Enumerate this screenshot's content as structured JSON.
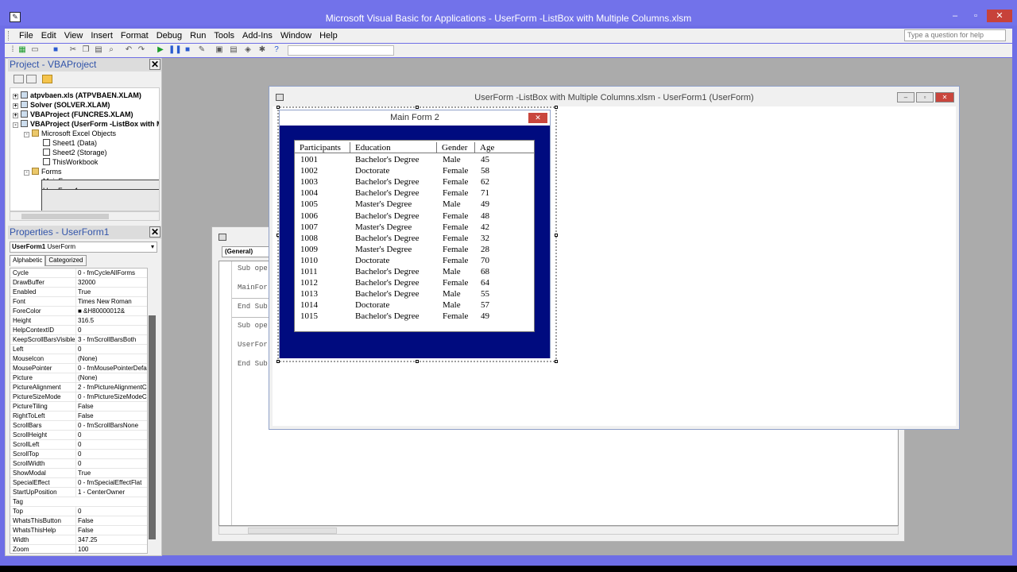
{
  "app": {
    "title": "Microsoft Visual Basic for Applications - UserForm -ListBox with Multiple Columns.xlsm",
    "window_buttons": [
      "‒",
      "▫",
      "✕"
    ]
  },
  "menu": [
    "File",
    "Edit",
    "View",
    "Insert",
    "Format",
    "Debug",
    "Run",
    "Tools",
    "Add-Ins",
    "Window",
    "Help"
  ],
  "help_placeholder": "Type a question for help",
  "project": {
    "title": "Project - VBAProject",
    "nodes": [
      {
        "label": "atpvbaen.xls (ATPVBAEN.XLAM)",
        "bold": true,
        "level": 0,
        "icon": "project-icon",
        "pm": "+"
      },
      {
        "label": "Solver (SOLVER.XLAM)",
        "bold": true,
        "level": 0,
        "icon": "project-icon",
        "pm": "+"
      },
      {
        "label": "VBAProject (FUNCRES.XLAM)",
        "bold": true,
        "level": 0,
        "icon": "project-icon",
        "pm": "+"
      },
      {
        "label": "VBAProject (UserForm -ListBox with Mult",
        "bold": true,
        "level": 0,
        "icon": "project-icon",
        "pm": "-"
      },
      {
        "label": "Microsoft Excel Objects",
        "bold": false,
        "level": 1,
        "icon": "folder-icon",
        "pm": "-"
      },
      {
        "label": "Sheet1 (Data)",
        "bold": false,
        "level": 2,
        "icon": "sheet-icon",
        "pm": ""
      },
      {
        "label": "Sheet2 (Storage)",
        "bold": false,
        "level": 2,
        "icon": "sheet-icon",
        "pm": ""
      },
      {
        "label": "ThisWorkbook",
        "bold": false,
        "level": 2,
        "icon": "sheet-icon",
        "pm": ""
      },
      {
        "label": "Forms",
        "bold": false,
        "level": 1,
        "icon": "folder-icon",
        "pm": "-"
      },
      {
        "label": "MainForm",
        "bold": false,
        "level": 2,
        "icon": "form-icon",
        "pm": ""
      },
      {
        "label": "UserForm1",
        "bold": false,
        "level": 2,
        "icon": "form-icon",
        "pm": ""
      }
    ]
  },
  "properties": {
    "title": "Properties - UserForm1",
    "object_name": "UserForm1",
    "object_type": "UserForm",
    "tabs": [
      "Alphabetic",
      "Categorized"
    ],
    "rows": [
      [
        "Cycle",
        "0 - fmCycleAllForms"
      ],
      [
        "DrawBuffer",
        "32000"
      ],
      [
        "Enabled",
        "True"
      ],
      [
        "Font",
        "Times New Roman"
      ],
      [
        "ForeColor",
        "■ &H80000012&"
      ],
      [
        "Height",
        "316.5"
      ],
      [
        "HelpContextID",
        "0"
      ],
      [
        "KeepScrollBarsVisible",
        "3 - fmScrollBarsBoth"
      ],
      [
        "Left",
        "0"
      ],
      [
        "MouseIcon",
        "(None)"
      ],
      [
        "MousePointer",
        "0 - fmMousePointerDefault"
      ],
      [
        "Picture",
        "(None)"
      ],
      [
        "PictureAlignment",
        "2 - fmPictureAlignmentCenter"
      ],
      [
        "PictureSizeMode",
        "0 - fmPictureSizeModeClip"
      ],
      [
        "PictureTiling",
        "False"
      ],
      [
        "RightToLeft",
        "False"
      ],
      [
        "ScrollBars",
        "0 - fmScrollBarsNone"
      ],
      [
        "ScrollHeight",
        "0"
      ],
      [
        "ScrollLeft",
        "0"
      ],
      [
        "ScrollTop",
        "0"
      ],
      [
        "ScrollWidth",
        "0"
      ],
      [
        "ShowModal",
        "True"
      ],
      [
        "SpecialEffect",
        "0 - fmSpecialEffectFlat"
      ],
      [
        "StartUpPosition",
        "1 - CenterOwner"
      ],
      [
        "Tag",
        ""
      ],
      [
        "Top",
        "0"
      ],
      [
        "WhatsThisButton",
        "False"
      ],
      [
        "WhatsThisHelp",
        "False"
      ],
      [
        "Width",
        "347.25"
      ],
      [
        "Zoom",
        "100"
      ]
    ]
  },
  "code": {
    "combo": "(General)",
    "lines": [
      "Sub ope",
      "MainFor",
      "End Sub",
      "Sub ope",
      "UserFor",
      "End Sub"
    ]
  },
  "userform_window": {
    "title": "UserForm -ListBox with Multiple Columns.xlsm - UserForm1 (UserForm)"
  },
  "form": {
    "title": "Main Form 2",
    "close": "✕",
    "headers": [
      "Participants",
      "Education",
      "Gender",
      "Age"
    ],
    "rows": [
      [
        "1001",
        "Bachelor's Degree",
        "Male",
        "45"
      ],
      [
        "1002",
        "Doctorate",
        "Female",
        "58"
      ],
      [
        "1003",
        "Bachelor's Degree",
        "Female",
        "62"
      ],
      [
        "1004",
        "Bachelor's Degree",
        "Female",
        "71"
      ],
      [
        "1005",
        "Master's Degree",
        "Male",
        "49"
      ],
      [
        "1006",
        "Bachelor's Degree",
        "Female",
        "48"
      ],
      [
        "1007",
        "Master's Degree",
        "Female",
        "42"
      ],
      [
        "1008",
        "Bachelor's Degree",
        "Female",
        "32"
      ],
      [
        "1009",
        "Master's Degree",
        "Female",
        "28"
      ],
      [
        "1010",
        "Doctorate",
        "Female",
        "70"
      ],
      [
        "1011",
        "Bachelor's Degree",
        "Male",
        "68"
      ],
      [
        "1012",
        "Bachelor's Degree",
        "Female",
        "64"
      ],
      [
        "1013",
        "Bachelor's Degree",
        "Male",
        "55"
      ],
      [
        "1014",
        "Doctorate",
        "Male",
        "57"
      ],
      [
        "1015",
        "Bachelor's Degree",
        "Female",
        "49"
      ]
    ]
  },
  "colors": {
    "titlebar": "#7272ea",
    "form_body": "#000b7f",
    "workspace": "#ababab",
    "close_button": "#c9463d"
  }
}
